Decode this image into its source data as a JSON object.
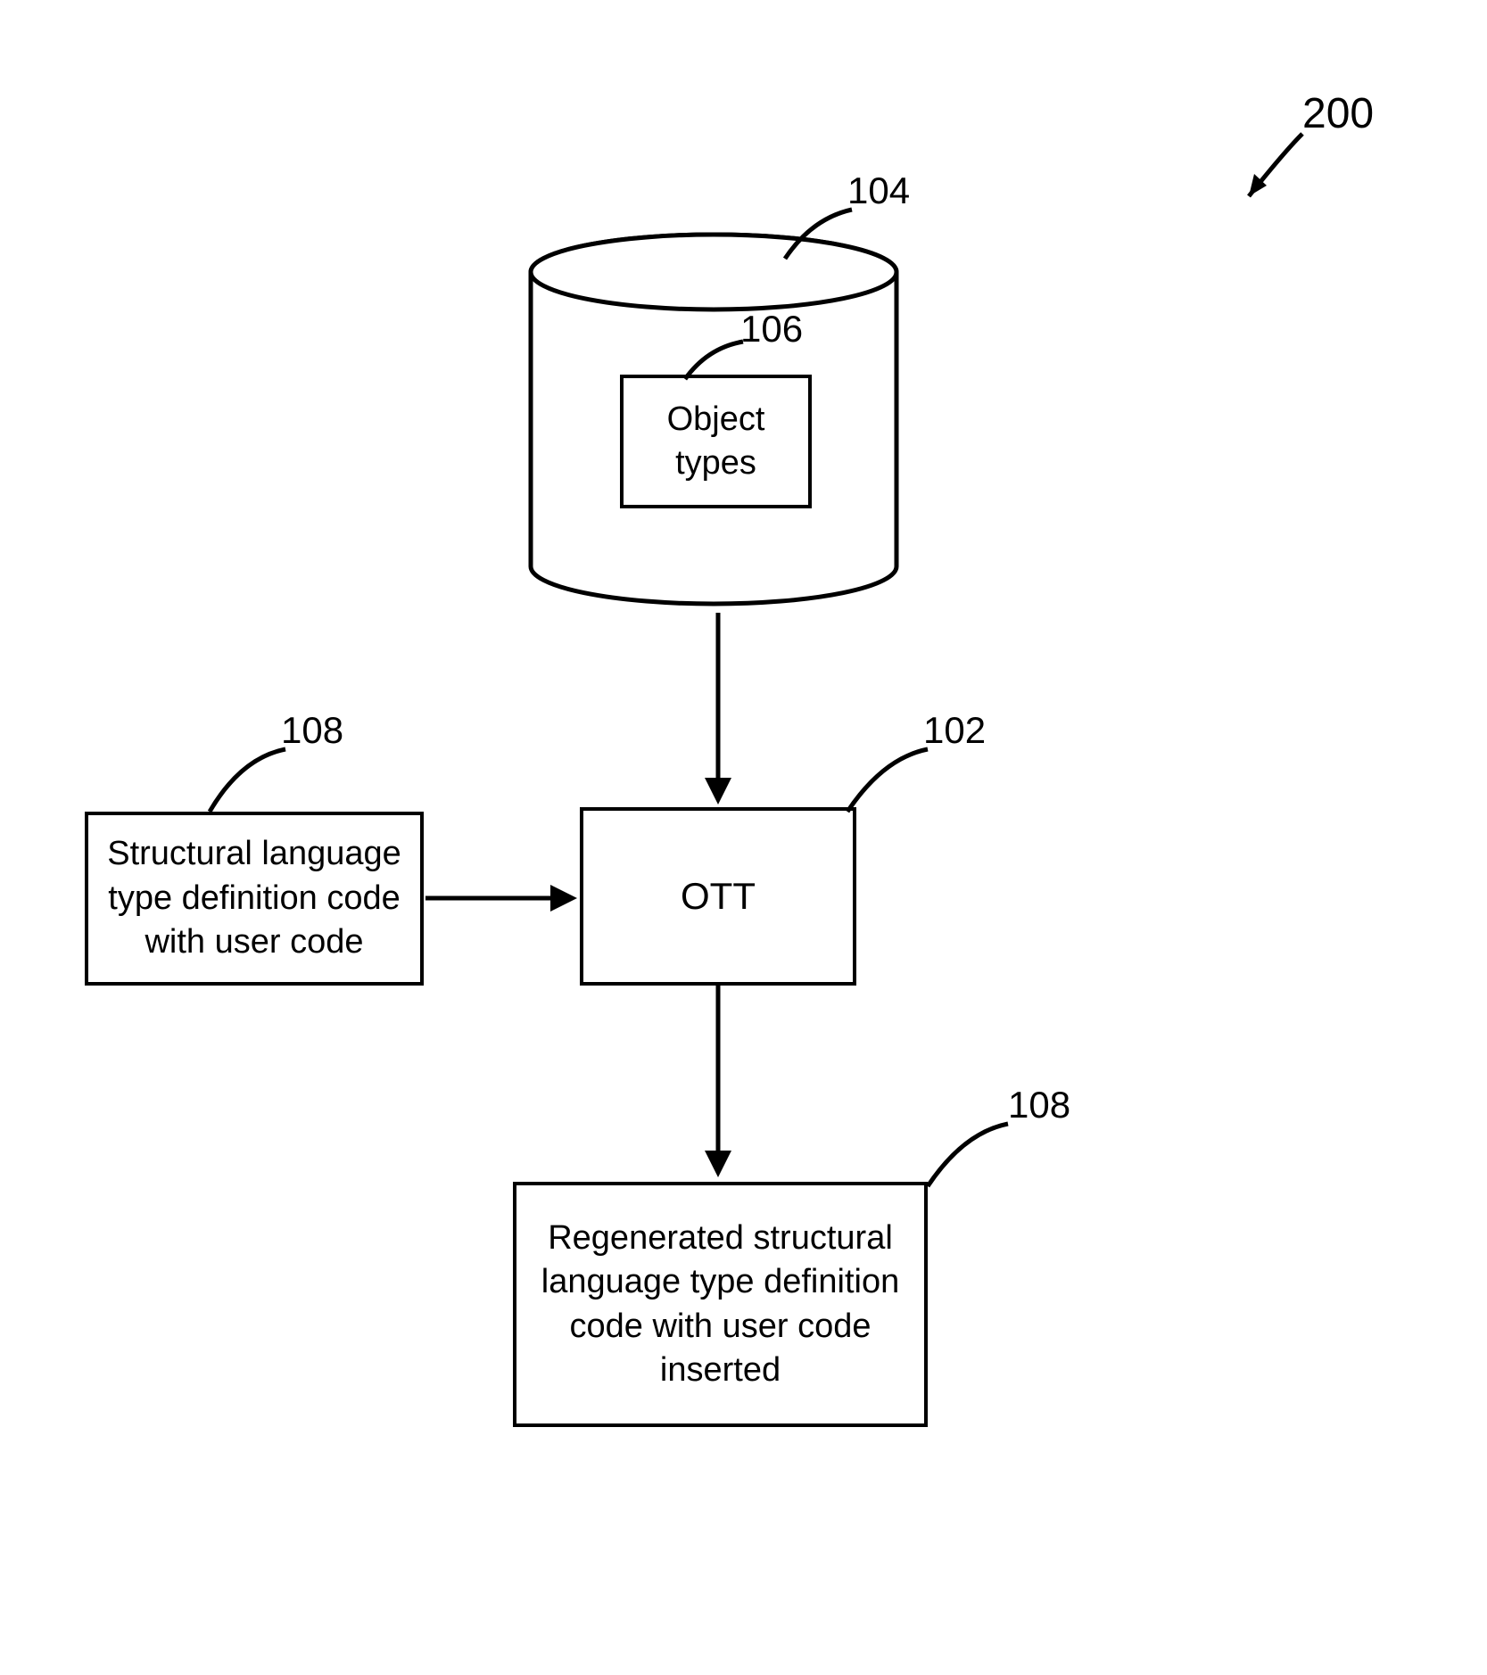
{
  "diagram": {
    "figure_label": "200",
    "nodes": {
      "database": {
        "label_num": "104"
      },
      "object_types": {
        "text": "Object\ntypes",
        "label_num": "106"
      },
      "structural_input": {
        "text": "Structural language type definition code with user code",
        "label_num": "108"
      },
      "ott": {
        "text": "OTT",
        "label_num": "102"
      },
      "output": {
        "text": "Regenerated structural language type definition code with user code inserted",
        "label_num": "108"
      }
    }
  }
}
